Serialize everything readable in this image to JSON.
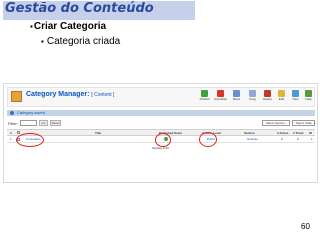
{
  "slide": {
    "title": "Gestão do Conteúdo",
    "bullet1": "Criar Categoria",
    "bullet2": "Categoria criada",
    "page_number": "60"
  },
  "screen": {
    "header_title": "Category Manager:",
    "header_context": "[ Content ]",
    "toolbar": [
      {
        "label": "Publish",
        "icon": "publish-icon",
        "color": "#3ea33e"
      },
      {
        "label": "Unpublish",
        "icon": "unpublish-icon",
        "color": "#d9342b"
      },
      {
        "label": "Move",
        "icon": "move-icon",
        "color": "#6a8fd0"
      },
      {
        "label": "Copy",
        "icon": "copy-icon",
        "color": "#8fa9d8"
      },
      {
        "label": "Delete",
        "icon": "delete-icon",
        "color": "#c0392b"
      },
      {
        "label": "Edit",
        "icon": "edit-icon",
        "color": "#e0b43c"
      },
      {
        "label": "New",
        "icon": "new-icon",
        "color": "#4b9bd6"
      },
      {
        "label": "Help",
        "icon": "help-icon",
        "color": "#5a9a3c"
      }
    ],
    "message": "Category saved",
    "filter": {
      "label": "Filter:",
      "go": "Go",
      "reset": "Reset",
      "section_select": "- Select Section -",
      "state_select": "- Select State -"
    },
    "table": {
      "headers": [
        "#",
        "Title",
        "Published",
        "Order",
        "Access Level",
        "Section",
        "# Active",
        "# Trash",
        "ID"
      ],
      "rows": [
        {
          "num": "1",
          "title": "Conteúdos",
          "access": "Public",
          "section": "Notícias",
          "active": "0",
          "trash": "0",
          "id": "1"
        }
      ],
      "footer": "Display # 20"
    },
    "annotation_color": "#e0221b",
    "accent": "#0b55c4"
  }
}
